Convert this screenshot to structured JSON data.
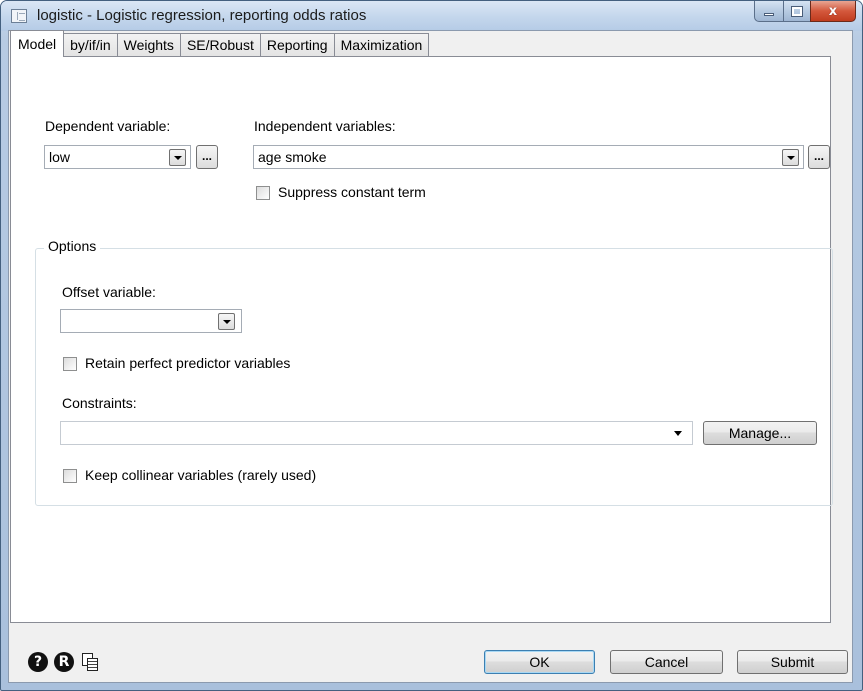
{
  "window": {
    "title": "logistic - Logistic regression, reporting odds ratios",
    "close_glyph": "x"
  },
  "tabs": [
    {
      "label": "Model",
      "active": true
    },
    {
      "label": "by/if/in"
    },
    {
      "label": "Weights"
    },
    {
      "label": "SE/Robust"
    },
    {
      "label": "Reporting"
    },
    {
      "label": "Maximization"
    }
  ],
  "model": {
    "dependent_label": "Dependent variable:",
    "dependent_value": "low",
    "independent_label": "Independent variables:",
    "independent_value": "age smoke",
    "suppress_constant_label": "Suppress constant term",
    "ellipsis": "..."
  },
  "options": {
    "legend": "Options",
    "offset_label": "Offset variable:",
    "offset_value": "",
    "retain_label": "Retain perfect predictor variables",
    "constraints_label": "Constraints:",
    "constraints_value": "",
    "manage_button": "Manage...",
    "collinear_label": "Keep collinear variables (rarely used)"
  },
  "footer": {
    "help_icon": "?",
    "r_icon": "R",
    "ok_button": "OK",
    "cancel_button": "Cancel",
    "submit_button": "Submit"
  }
}
